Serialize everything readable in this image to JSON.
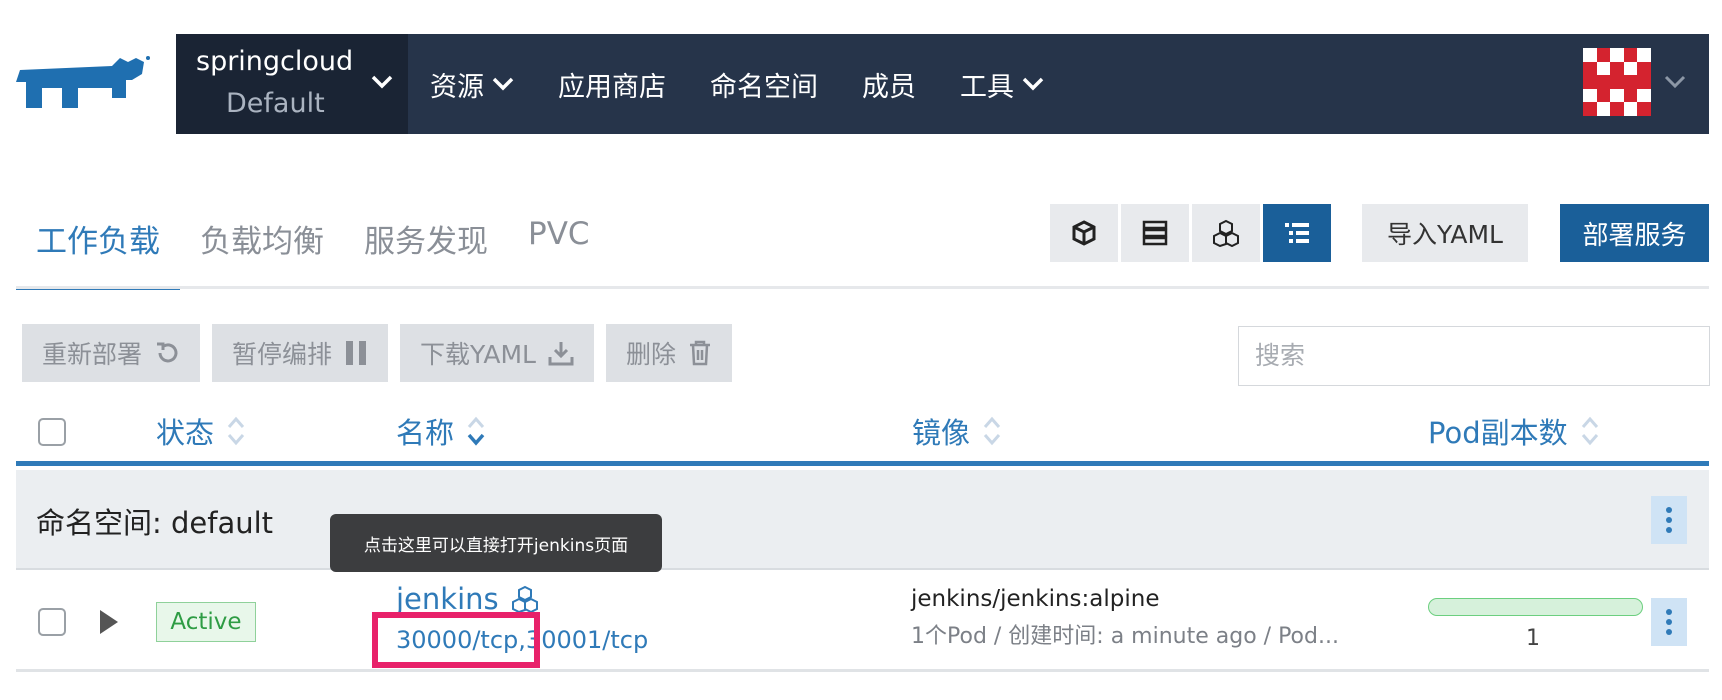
{
  "header": {
    "cluster_name": "springcloud",
    "project_name": "Default",
    "nav": [
      "资源",
      "应用商店",
      "命名空间",
      "成员",
      "工具"
    ],
    "brand_color": "#26344a"
  },
  "tabs": [
    "工作负载",
    "负载均衡",
    "服务发现",
    "PVC"
  ],
  "toolbar": {
    "import_label": "导入YAML",
    "deploy_label": "部署服务"
  },
  "actions": {
    "redeploy": "重新部署",
    "pause": "暂停编排",
    "download": "下载YAML",
    "delete": "删除"
  },
  "search": {
    "placeholder": "搜索",
    "value": ""
  },
  "table": {
    "columns": [
      "状态",
      "名称",
      "镜像",
      "Pod副本数"
    ],
    "group_label": "命名空间: default",
    "rows": [
      {
        "state": "Active",
        "name": "jenkins",
        "port1": "30000/tcp",
        "port_sep": ",",
        "port2": "30001/tcp",
        "image": "jenkins/jenkins:alpine",
        "meta": "1个Pod / 创建时间: a minute ago / Pod...",
        "pod_count": "1",
        "pod_ready_fraction": 1.0
      }
    ]
  },
  "tooltip": "点击这里可以直接打开jenkins页面",
  "colors": {
    "accent": "#2f7ab8",
    "primary_button": "#1a5f99",
    "highlight": "#e8216a",
    "active_badge": "#2e9c44"
  }
}
